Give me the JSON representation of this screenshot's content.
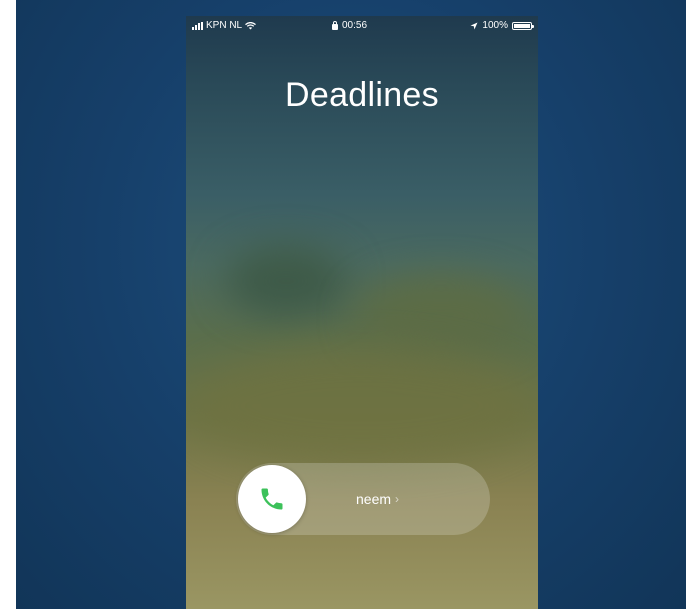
{
  "status_bar": {
    "carrier": "KPN NL",
    "time": "00:56",
    "battery": "100%",
    "battery_level": 1.0
  },
  "call": {
    "caller_name": "Deadlines",
    "slide_label": "neem"
  },
  "icons": {
    "signal": "signal-bars-icon",
    "wifi": "wifi-icon",
    "lock": "lock-icon",
    "location": "location-arrow-icon",
    "battery": "battery-icon",
    "phone": "phone-handset-icon"
  },
  "colors": {
    "background": "#163f69",
    "accept_green": "#3cc15a",
    "text": "#ffffff"
  }
}
